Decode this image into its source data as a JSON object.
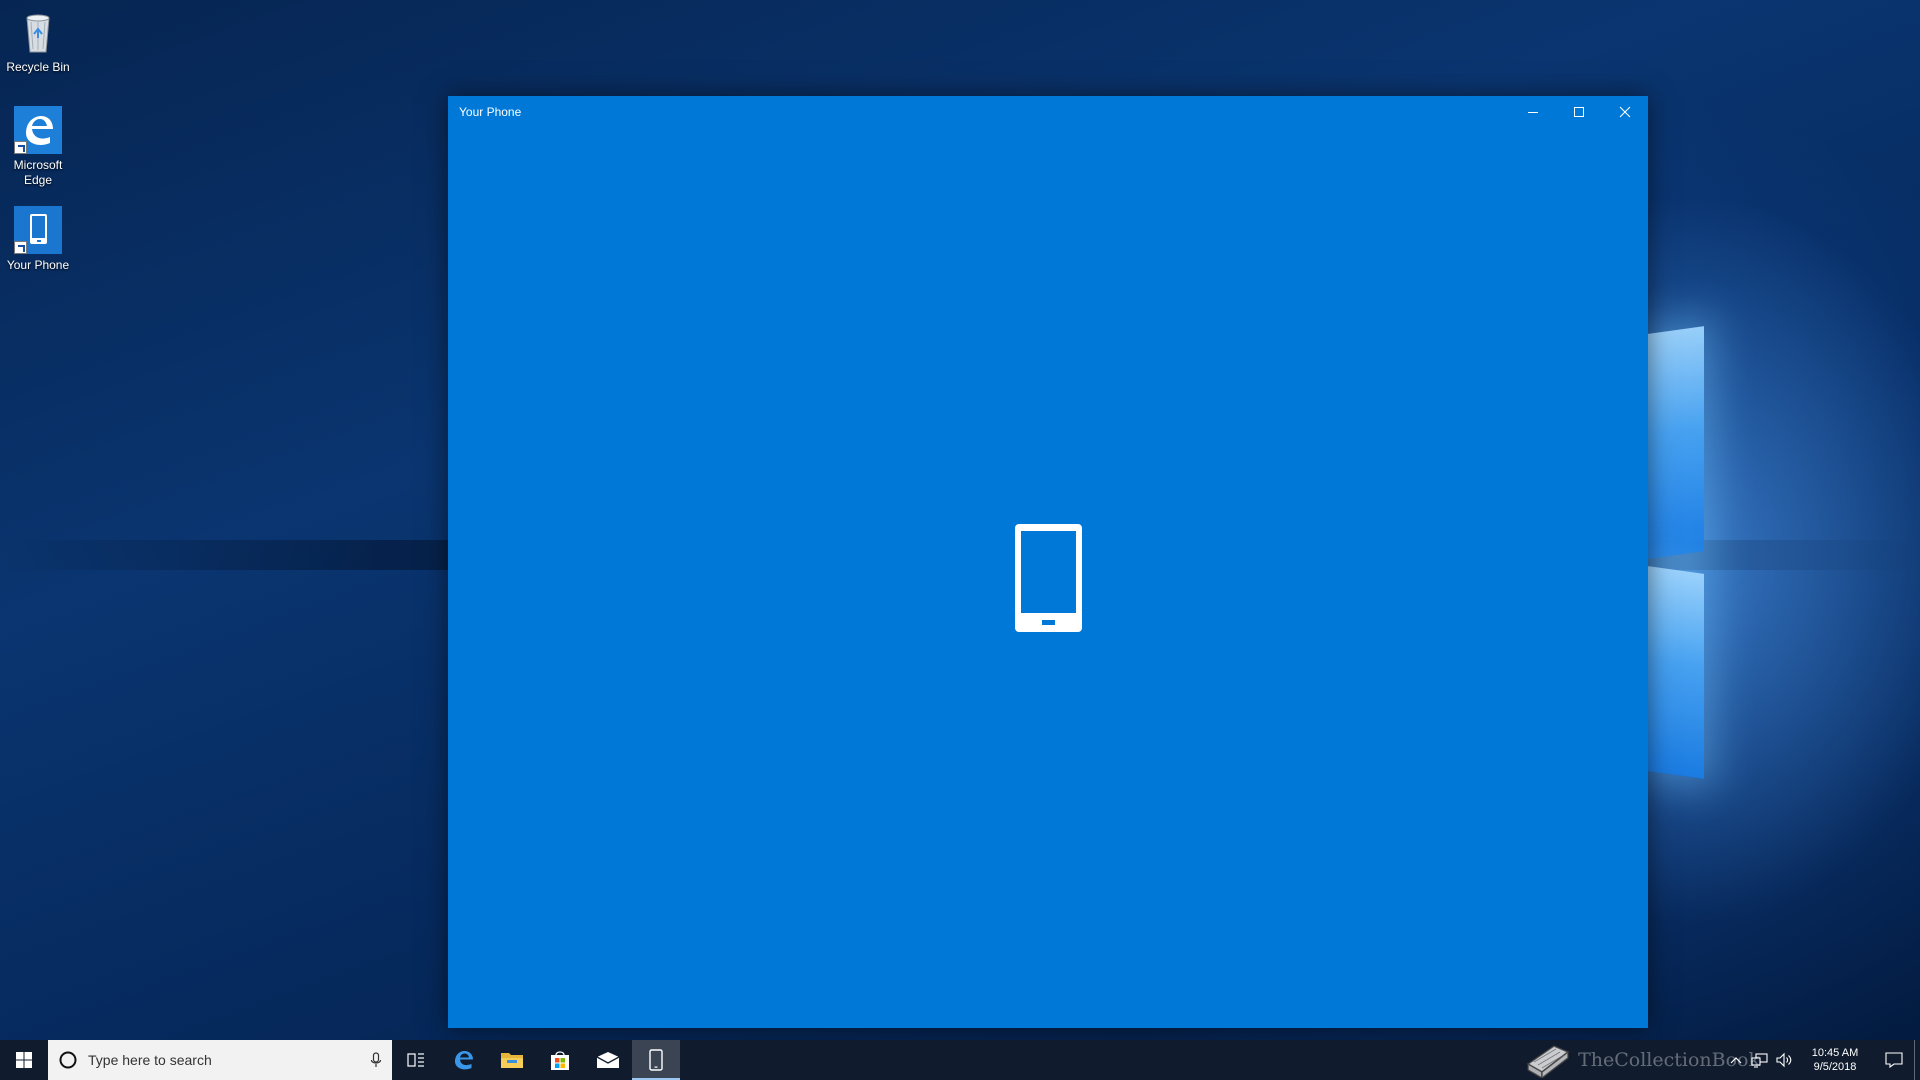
{
  "desktop": {
    "icons": [
      {
        "label": "Recycle Bin",
        "icon": "recycle-bin-icon"
      },
      {
        "label": "Microsoft Edge",
        "icon": "edge-icon"
      },
      {
        "label": "Your Phone",
        "icon": "phone-icon"
      }
    ]
  },
  "window": {
    "title": "Your Phone",
    "accent_color": "#0078d7",
    "center_icon": "phone-icon"
  },
  "taskbar": {
    "search_placeholder": "Type here to search",
    "apps": [
      "task-view-icon",
      "edge-icon",
      "file-explorer-icon",
      "store-icon",
      "mail-icon",
      "phone-icon"
    ],
    "active_app": "Your Phone"
  },
  "tray": {
    "time": "10:45 AM",
    "date": "9/5/2018"
  },
  "watermark": {
    "text": "TheCollectionBook"
  }
}
